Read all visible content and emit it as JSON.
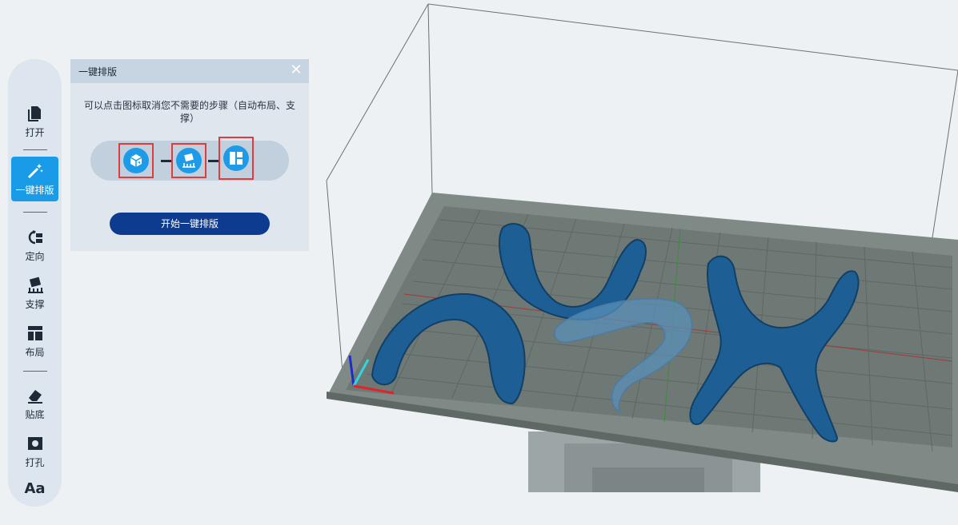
{
  "sidebar": {
    "items": [
      {
        "label": "打开",
        "icon": "file-open-icon"
      },
      {
        "label": "一键排版",
        "icon": "magic-wand-icon",
        "active": true
      },
      {
        "label": "定向",
        "icon": "orientation-icon"
      },
      {
        "label": "支撑",
        "icon": "support-icon"
      },
      {
        "label": "布局",
        "icon": "layout-icon"
      },
      {
        "label": "贴底",
        "icon": "eraser-icon"
      },
      {
        "label": "打孔",
        "icon": "hole-icon"
      },
      {
        "label": "Aa",
        "icon": "text-icon"
      }
    ]
  },
  "panel": {
    "title": "一键排版",
    "hint": "可以点击图标取消您不需要的步骤（自动布局、支撑）",
    "steps": [
      {
        "icon": "orientation-cube-icon"
      },
      {
        "icon": "support-icon"
      },
      {
        "icon": "layout-grid-icon"
      }
    ],
    "start_label": "开始一键排版"
  },
  "colors": {
    "accent": "#1a9be8",
    "primary_button": "#0d3b90",
    "model": "#1d5f94",
    "platform": "#7f8a86",
    "step_highlight": "#e23b3b"
  }
}
